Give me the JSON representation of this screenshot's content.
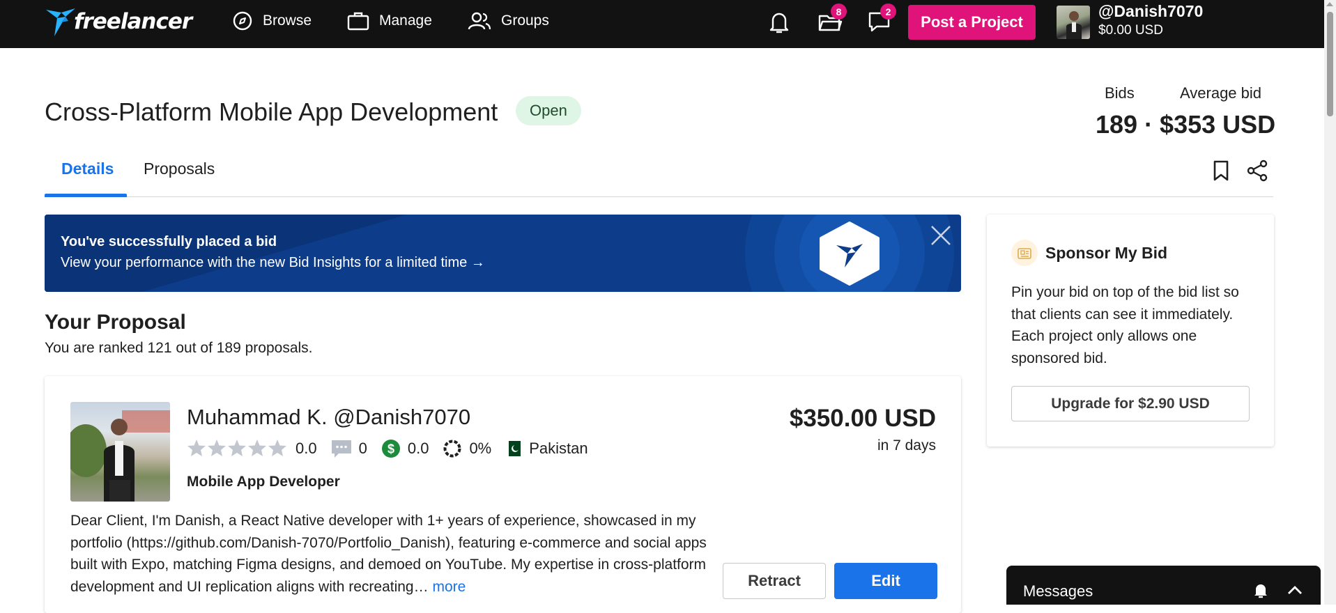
{
  "header": {
    "logo_text": "freelancer",
    "nav": [
      {
        "label": "Browse",
        "icon": "compass-icon"
      },
      {
        "label": "Manage",
        "icon": "briefcase-icon"
      },
      {
        "label": "Groups",
        "icon": "users-icon"
      }
    ],
    "notifications": {
      "icon": "bell-icon"
    },
    "projects": {
      "icon": "folder-icon",
      "count": "8"
    },
    "messages": {
      "icon": "chat-icon",
      "count": "2"
    },
    "post_project_label": "Post a Project",
    "user": {
      "username": "@Danish7070",
      "balance": "$0.00 USD"
    }
  },
  "project": {
    "title": "Cross-Platform Mobile App Development",
    "status": "Open",
    "bids_label": "Bids",
    "avg_bid_label": "Average bid",
    "bids_value": "189 · $353 USD"
  },
  "tabs": [
    {
      "label": "Details",
      "active": true
    },
    {
      "label": "Proposals",
      "active": false
    }
  ],
  "banner": {
    "line1": "You've successfully placed a bid",
    "line2": "View your performance with the new Bid Insights for a limited time →"
  },
  "proposal": {
    "heading": "Your Proposal",
    "rank_text": "You are ranked 121 out of 189 proposals.",
    "name": "Muhammad K. @Danish7070",
    "rating": "0.0",
    "reviews": "0",
    "earnings": "0.0",
    "completion": "0%",
    "country": "Pakistan",
    "role": "Mobile App Developer",
    "amount": "$350.00 USD",
    "duration": "in 7 days",
    "description": "Dear Client, I'm Danish, a React Native developer with 1+ years of experience, showcased in my portfolio (https://github.com/Danish-7070/Portfolio_Danish), featuring e-commerce and social apps built with Expo, matching Figma designs, and demoed on YouTube. My expertise in cross-platform development and UI replication aligns with recreating…",
    "more_label": "more",
    "retract_label": "Retract",
    "edit_label": "Edit"
  },
  "sponsor": {
    "title": "Sponsor My Bid",
    "text": "Pin your bid on top of the bid list so that clients can see it immediately. Each project only allows one sponsored bid.",
    "button_label": "Upgrade for $2.90 USD"
  },
  "messages_panel": {
    "label": "Messages"
  },
  "colors": {
    "topbar": "#121212",
    "brand_pink": "#e0137a",
    "primary_blue": "#1a73e8",
    "banner_blue": "#0c3c8a",
    "open_badge_bg": "#dff5e6",
    "earnings_green": "#1e8a3c"
  }
}
